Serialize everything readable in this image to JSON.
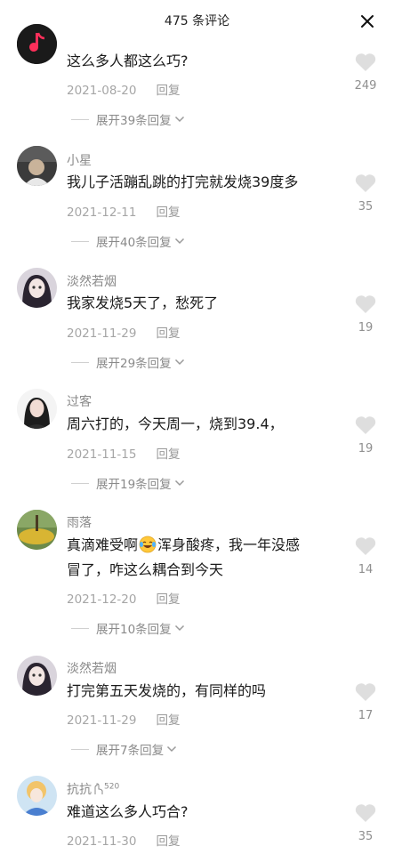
{
  "header": {
    "title": "475 条评论"
  },
  "comments": [
    {
      "username": "",
      "text": "这么多人都这么巧?",
      "date": "2021-08-20",
      "reply_label": "回复",
      "likes": "249",
      "expand_label": "展开39条回复"
    },
    {
      "username": "小星",
      "text": "我儿子活蹦乱跳的打完就发烧39度多",
      "date": "2021-12-11",
      "reply_label": "回复",
      "likes": "35",
      "expand_label": "展开40条回复"
    },
    {
      "username": "淡然若烟",
      "text": "我家发烧5天了，愁死了",
      "date": "2021-11-29",
      "reply_label": "回复",
      "likes": "19",
      "expand_label": "展开29条回复"
    },
    {
      "username": "过客",
      "text": "周六打的，今天周一，烧到39.4，",
      "date": "2021-11-15",
      "reply_label": "回复",
      "likes": "19",
      "expand_label": "展开19条回复"
    },
    {
      "username": "雨落",
      "text_part1": "真滴难受啊",
      "text_part2": "浑身酸疼，我一年没感",
      "text_line2": "冒了，咋这么耦合到今天",
      "date": "2021-12-20",
      "reply_label": "回复",
      "likes": "14",
      "expand_label": "展开10条回复"
    },
    {
      "username": "淡然若烟",
      "text": "打完第五天发烧的，有同样的吗",
      "date": "2021-11-29",
      "reply_label": "回复",
      "likes": "17",
      "expand_label": "展开7条回复"
    },
    {
      "username": "抗抗",
      "username_tag": "520",
      "text": "难道这么多人巧合?",
      "date": "2021-11-30",
      "reply_label": "回复",
      "likes": "35"
    }
  ],
  "colors": {
    "like_icon": "#dedede",
    "meta_text": "#a6a6a6",
    "username_text": "#8a8a8a"
  },
  "icons": {
    "close": "close-icon",
    "like": "heart-icon",
    "expand": "chevron-down-icon",
    "emoji": "crying-laughing-emoji"
  }
}
